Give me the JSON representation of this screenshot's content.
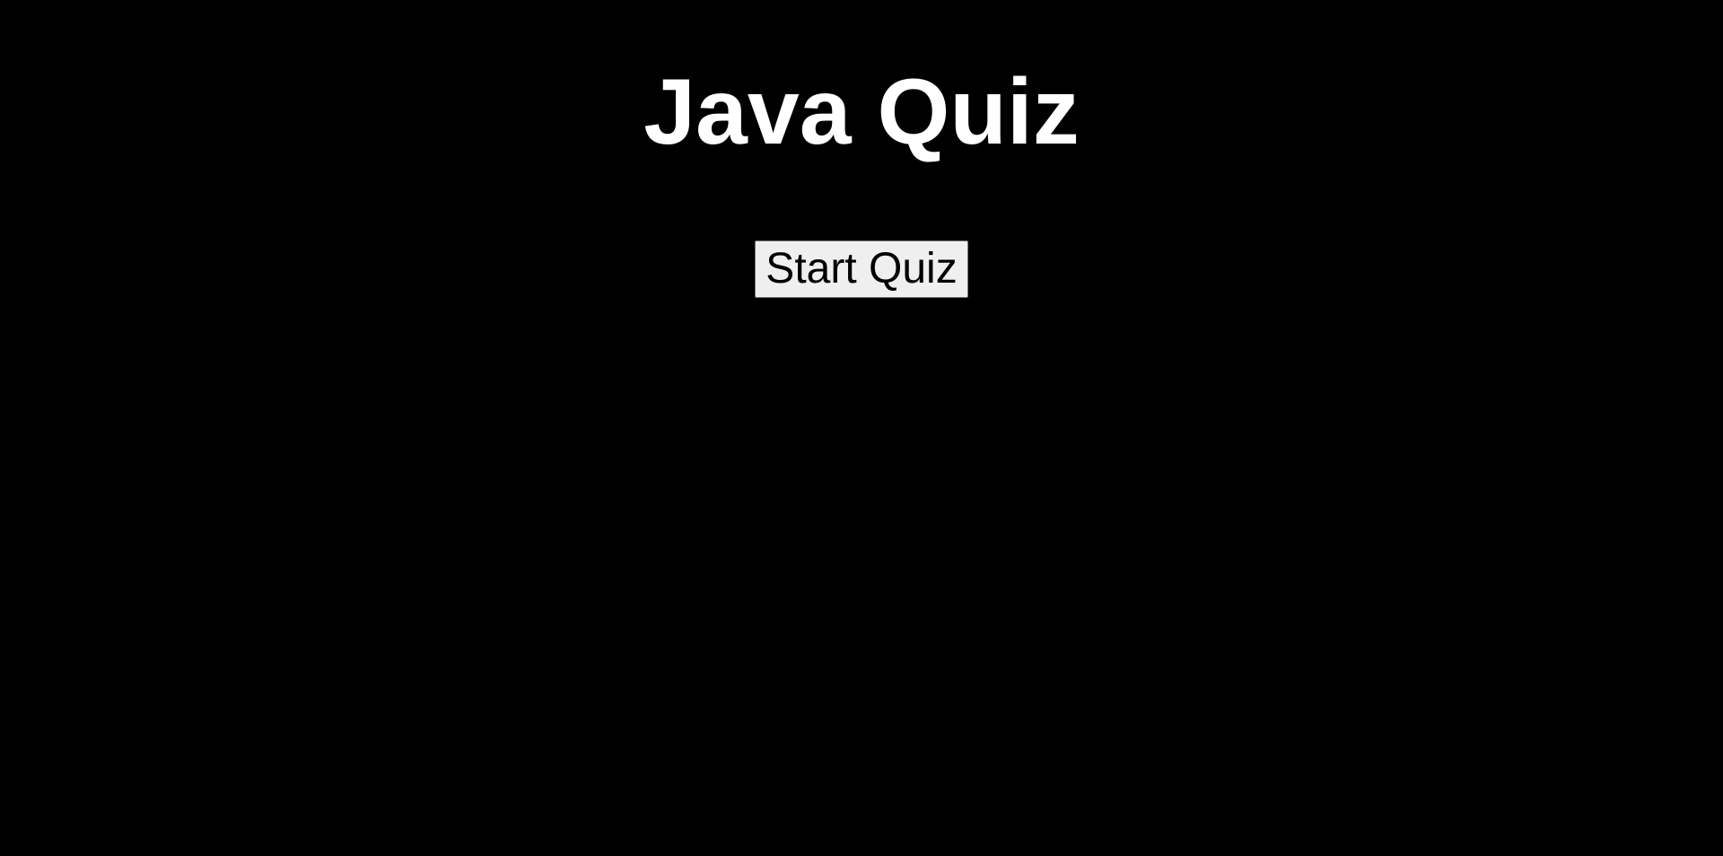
{
  "page": {
    "title": "Java Quiz",
    "background_color": "#000000",
    "title_color": "#ffffff"
  },
  "controls": {
    "start_label": "Start Quiz",
    "button_color": "#efefef"
  }
}
